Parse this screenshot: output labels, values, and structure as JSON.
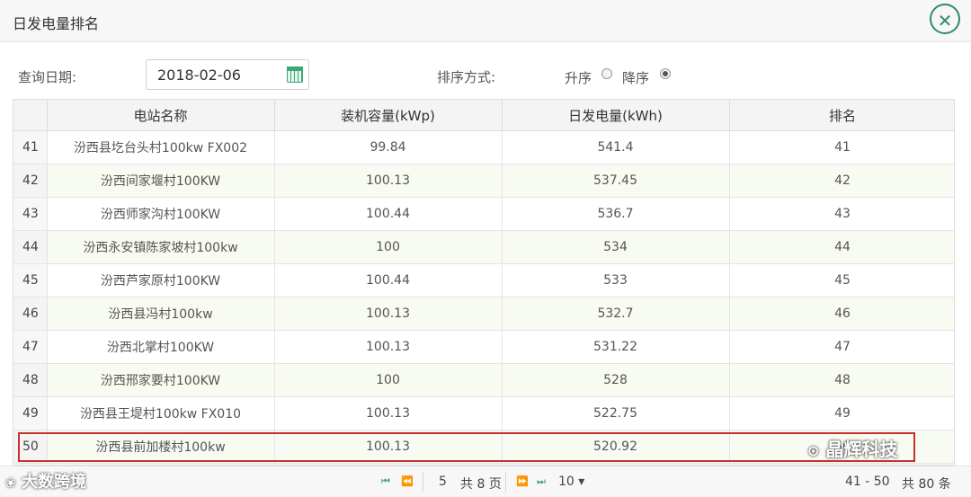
{
  "window": {
    "title": "日发电量排名",
    "close_icon": "close-circle-icon"
  },
  "filters": {
    "date_label": "查询日期:",
    "date_value": "2018-02-06",
    "sort_label": "排序方式:",
    "sort_asc": "升序",
    "sort_desc": "降序",
    "sort_selected": "降序"
  },
  "table": {
    "headers": [
      "",
      "电站名称",
      "装机容量(kWp)",
      "日发电量(kWh)",
      "排名"
    ],
    "rows": [
      [
        "41",
        "汾西县圪台头村100kw  FX002",
        "99.84",
        "541.4",
        "41"
      ],
      [
        "42",
        "汾西间家堰村100KW",
        "100.13",
        "537.45",
        "42"
      ],
      [
        "43",
        "汾西师家沟村100KW",
        "100.44",
        "536.7",
        "43"
      ],
      [
        "44",
        "汾西永安镇陈家坡村100kw",
        "100",
        "534",
        "44"
      ],
      [
        "45",
        "汾西芦家原村100KW",
        "100.44",
        "533",
        "45"
      ],
      [
        "46",
        "汾西县冯村100kw",
        "100.13",
        "532.7",
        "46"
      ],
      [
        "47",
        "汾西北掌村100KW",
        "100.13",
        "531.22",
        "47"
      ],
      [
        "48",
        "汾西邢家要村100KW",
        "100",
        "528",
        "48"
      ],
      [
        "49",
        "汾西县王堤村100kw  FX010",
        "100.13",
        "522.75",
        "49"
      ],
      [
        "50",
        "汾西县前加楼村100kw",
        "100.13",
        "520.92",
        "50"
      ]
    ]
  },
  "pagination": {
    "current_page": "5",
    "total_pages_text": "共 8 页",
    "page_size": "10",
    "range_text": "41 - 50",
    "total_text": "共 80 条"
  },
  "watermarks": {
    "left": "大数跨境",
    "right": "晶辉科技"
  },
  "colors": {
    "accent": "#2f8a6c",
    "highlight": "#c9302c"
  }
}
